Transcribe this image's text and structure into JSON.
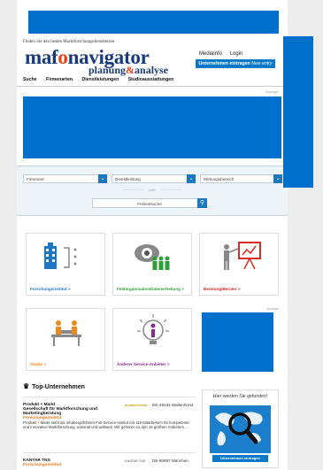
{
  "header": {
    "tagline": "Finden Sie den besten Marktforschungsdienstleister",
    "logo": {
      "part1": "maf",
      "part2": "o",
      "part3": "navigator",
      "sub1": "planung",
      "sub2": "&",
      "sub3": "analyse"
    },
    "links": [
      "Mediainfo",
      "Login"
    ],
    "entry_button": {
      "label": "Unternehmen eintragen",
      "italic": "New entry"
    }
  },
  "nav": {
    "items": [
      "Suche",
      "Firmenarten",
      "Dienstleistungen",
      "Studioausstattungen"
    ]
  },
  "ads": {
    "label": "Anzeige"
  },
  "search": {
    "selects": [
      "Firmenart",
      "Dienstleistung",
      "Wirkungsbereich"
    ],
    "or_label": "oder",
    "text_placeholder": "Freitextsuche"
  },
  "categories": [
    {
      "label": "Forschungsinstitut",
      "arrow": ">",
      "color": "#1f77c4"
    },
    {
      "label": "Feldorganisation/Datenerhebung",
      "arrow": ">",
      "color": "#2f9e3a"
    },
    {
      "label": "Beratung/Berater",
      "arrow": ">",
      "color": "#d92b24"
    },
    {
      "label": "Studio",
      "arrow": ">",
      "color": "#f0891c"
    },
    {
      "label": "Anderer Service-Anbieter",
      "arrow": ">",
      "color": "#8a2a8f"
    }
  ],
  "top_companies": {
    "heading": "Top-Unternehmen",
    "items": [
      {
        "name": "Produkt + Markt",
        "subtitle": "Gesellschaft für Marktforschung und Marketingberatung",
        "type": "Forschungsinstitut",
        "description": "Produkt + Markt steht als inhabergeführtes Full-Service-Institut mit 119 Mitarbeitern für kompetente und innovative Marktforschung, national und weltweit. Wir gehören zu den 15 größten Anbietern ...",
        "logo_text": "produkt+markt",
        "location": "DE-49134 Wallenhorst"
      },
      {
        "name": "KANTAR TNS",
        "subtitle": "",
        "type": "Forschungsinstitut",
        "description": "",
        "logo_text": "KANTAR TNS",
        "location": "DE-80687 München"
      }
    ]
  },
  "find_box": {
    "title": "Hier werden Sie gefunden!",
    "button": "Unternehmen eintragen"
  },
  "colors": {
    "brand_blue": "#0070cc",
    "logo_navy": "#1a3b7a",
    "logo_orange": "#e6401d"
  }
}
